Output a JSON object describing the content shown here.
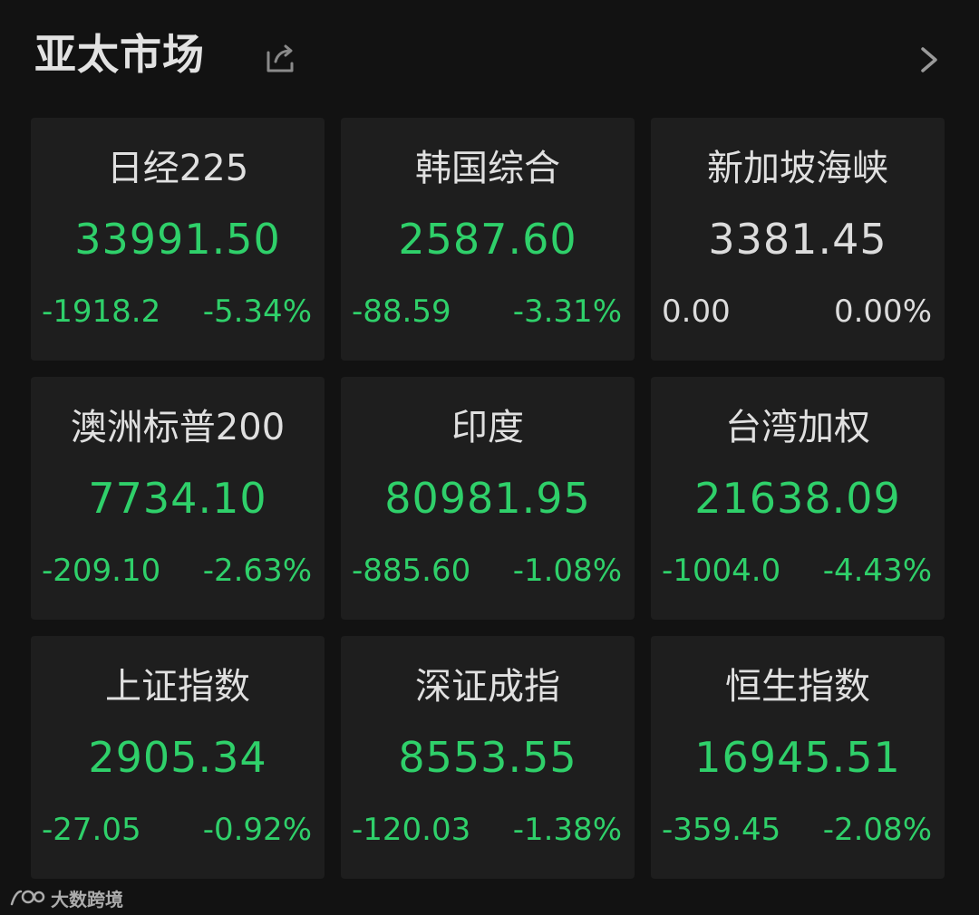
{
  "header": {
    "title": "亚太市场"
  },
  "icons": {
    "share": "share-icon",
    "chevron": "chevron-right-icon"
  },
  "colors": {
    "down": "#2fd06a",
    "flat": "#dcdcdc",
    "card_bg": "#1e1e1e",
    "page_bg": "#121212"
  },
  "cards": [
    {
      "name": "日经225",
      "price": "33991.50",
      "change": "-1918.2",
      "pct": "-5.34%",
      "trend": "down"
    },
    {
      "name": "韩国综合",
      "price": "2587.60",
      "change": "-88.59",
      "pct": "-3.31%",
      "trend": "down"
    },
    {
      "name": "新加坡海峡",
      "price": "3381.45",
      "change": "0.00",
      "pct": "0.00%",
      "trend": "flat"
    },
    {
      "name": "澳洲标普200",
      "price": "7734.10",
      "change": "-209.10",
      "pct": "-2.63%",
      "trend": "down"
    },
    {
      "name": "印度",
      "price": "80981.95",
      "change": "-885.60",
      "pct": "-1.08%",
      "trend": "down"
    },
    {
      "name": "台湾加权",
      "price": "21638.09",
      "change": "-1004.0",
      "pct": "-4.43%",
      "trend": "down"
    },
    {
      "name": "上证指数",
      "price": "2905.34",
      "change": "-27.05",
      "pct": "-0.92%",
      "trend": "down"
    },
    {
      "name": "深证成指",
      "price": "8553.55",
      "change": "-120.03",
      "pct": "-1.38%",
      "trend": "down"
    },
    {
      "name": "恒生指数",
      "price": "16945.51",
      "change": "-359.45",
      "pct": "-2.08%",
      "trend": "down"
    }
  ],
  "watermark": {
    "text": "大数跨境"
  }
}
